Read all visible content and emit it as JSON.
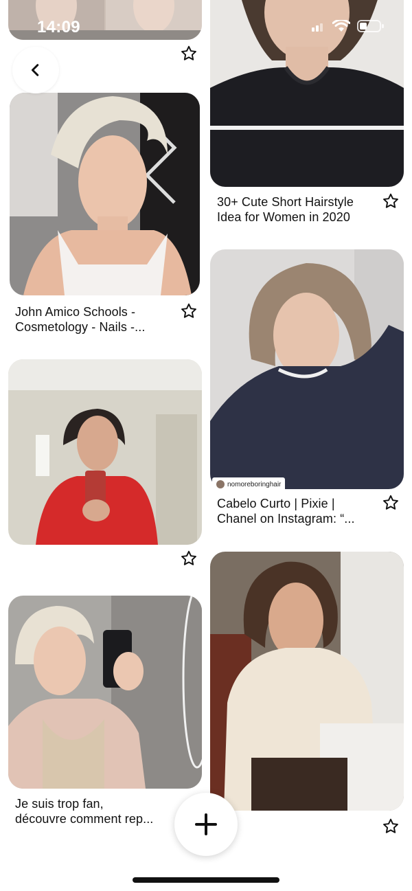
{
  "status_bar": {
    "time": "14:09"
  },
  "icons": {
    "back": "chevron-left-icon",
    "save": "star-icon",
    "add": "plus-icon",
    "signal": "cellular-signal-icon",
    "wifi": "wifi-icon",
    "battery": "battery-icon"
  },
  "pins": [
    {
      "caption": ""
    },
    {
      "caption": "30+ Cute Short Hairstyle\nIdea for Women in 2020"
    },
    {
      "caption": "John Amico Schools -\nCosmetology - Nails -..."
    },
    {
      "caption": "Cabelo Curto | Pixie |\nChanel on Instagram: “..."
    },
    {
      "caption": ""
    },
    {
      "caption": "Je suis trop fan,\ndécouvre comment rep..."
    },
    {
      "caption": ""
    }
  ],
  "image_watermark": "nomoreboringhair",
  "colors": {
    "background": "#ffffff",
    "text": "#111111",
    "icon": "#111111"
  }
}
